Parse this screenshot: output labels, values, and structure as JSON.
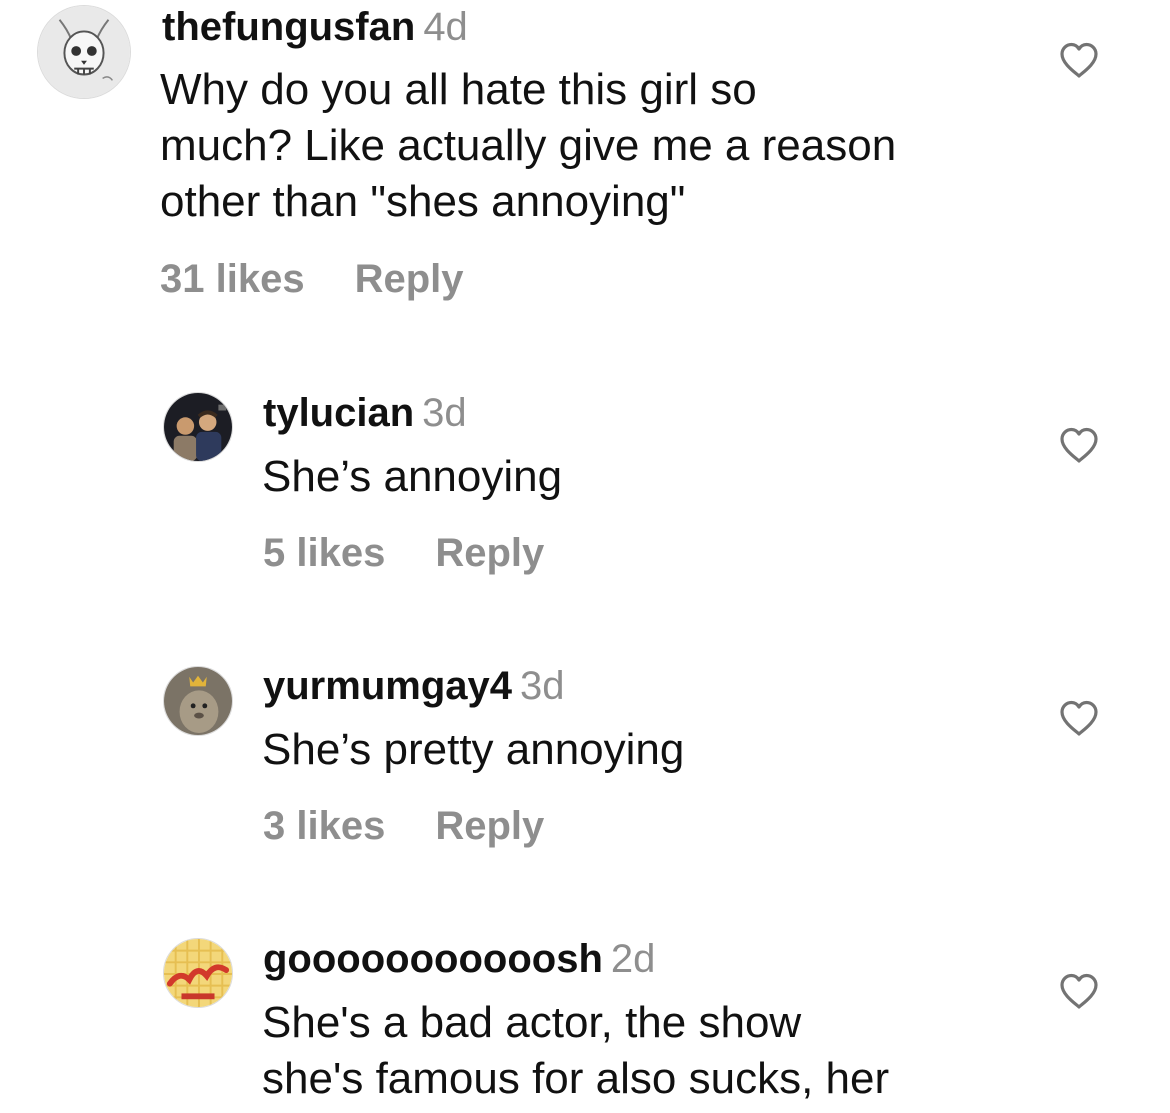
{
  "comments": [
    {
      "username": "thefungusfan",
      "time": "4d",
      "text_lines": [
        "Why do you all hate this girl so",
        "much? Like actually give me a reason",
        "other than \"shes annoying\""
      ],
      "likes": "31 likes",
      "reply_label": "Reply",
      "avatar": "skull-drawing-avatar",
      "like_icon": "heart-outline-icon"
    },
    {
      "username": "tylucian",
      "time": "3d",
      "text_lines": [
        "She’s annoying"
      ],
      "likes": "5 likes",
      "reply_label": "Reply",
      "avatar": "two-people-photo-avatar",
      "like_icon": "heart-outline-icon"
    },
    {
      "username": "yurmumgay4",
      "time": "3d",
      "text_lines": [
        "She’s pretty annoying"
      ],
      "likes": "3 likes",
      "reply_label": "Reply",
      "avatar": "crowned-animal-avatar",
      "like_icon": "heart-outline-icon"
    },
    {
      "username": "gooooooooooosh",
      "time": "2d",
      "text_lines": [
        "She's a bad actor, the show",
        "she's famous for also sucks, her"
      ],
      "avatar": "waffle-logo-avatar",
      "like_icon": "heart-outline-icon"
    }
  ],
  "colors": {
    "text": "#111111",
    "secondary": "#8e8e8e",
    "background": "#ffffff"
  }
}
